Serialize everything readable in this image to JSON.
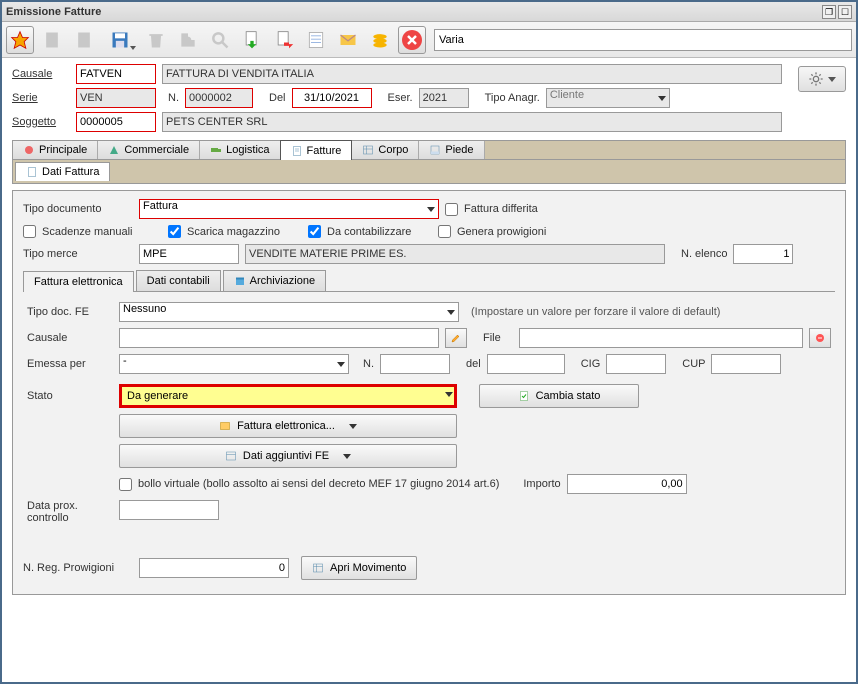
{
  "window": {
    "title": "Emissione Fatture"
  },
  "toolbar": {
    "varia": "Varia"
  },
  "header": {
    "causale_lbl": "Causale",
    "causale_val": "FATVEN",
    "causale_desc": "FATTURA DI VENDITA ITALIA",
    "serie_lbl": "Serie",
    "serie_val": "VEN",
    "n_lbl": "N.",
    "n_val": "0000002",
    "del_lbl": "Del",
    "del_val": "31/10/2021",
    "eser_lbl": "Eser.",
    "eser_val": "2021",
    "tipo_anagr_lbl": "Tipo Anagr.",
    "tipo_anagr_val": "Cliente",
    "soggetto_lbl": "Soggetto",
    "soggetto_val": "0000005",
    "soggetto_desc": "PETS CENTER SRL"
  },
  "tabs": {
    "principale": "Principale",
    "commerciale": "Commerciale",
    "logistica": "Logistica",
    "fatture": "Fatture",
    "corpo": "Corpo",
    "piede": "Piede"
  },
  "subtab": {
    "dati_fattura": "Dati Fattura"
  },
  "fattura": {
    "tipo_doc_lbl": "Tipo documento",
    "tipo_doc_val": "Fattura",
    "differita_lbl": "Fattura differita",
    "scadenze_manuali": "Scadenze manuali",
    "scarica_mag": "Scarica magazzino",
    "da_contab": "Da contabilizzare",
    "genera_prov": "Genera prowigioni",
    "tipo_merce_lbl": "Tipo merce",
    "tipo_merce_val": "MPE",
    "tipo_merce_desc": "VENDITE MATERIE PRIME ES.",
    "n_elenco_lbl": "N. elenco",
    "n_elenco_val": "1"
  },
  "inner_tabs": {
    "fe": "Fattura elettronica",
    "dati_cont": "Dati contabili",
    "arch": "Archiviazione"
  },
  "fe": {
    "tipo_doc_fe_lbl": "Tipo doc. FE",
    "tipo_doc_fe_val": "Nessuno",
    "hint": "(Impostare un valore per forzare il valore di default)",
    "causale_lbl": "Causale",
    "causale_val": "",
    "file_lbl": "File",
    "file_val": "",
    "emessa_per_lbl": "Emessa per",
    "emessa_per_val": "-",
    "n_lbl": "N.",
    "n_val": "",
    "del_lbl": "del",
    "del_val": "",
    "cig_lbl": "CIG",
    "cig_val": "",
    "cup_lbl": "CUP",
    "cup_val": "",
    "stato_lbl": "Stato",
    "stato_val": "Da generare",
    "cambia_stato": "Cambia stato",
    "btn_fe": "Fattura elettronica...",
    "btn_dati_agg": "Dati aggiuntivi FE",
    "bollo_lbl": "bollo virtuale (bollo assolto ai sensi del decreto MEF 17 giugno 2014 art.6)",
    "importo_lbl": "Importo",
    "importo_val": "0,00",
    "data_prox_lbl": "Data prox. controllo",
    "data_prox_val": ""
  },
  "footer": {
    "n_reg_prov_lbl": "N. Reg. Prowigioni",
    "n_reg_prov_val": "0",
    "apri_mov": "Apri Movimento"
  }
}
